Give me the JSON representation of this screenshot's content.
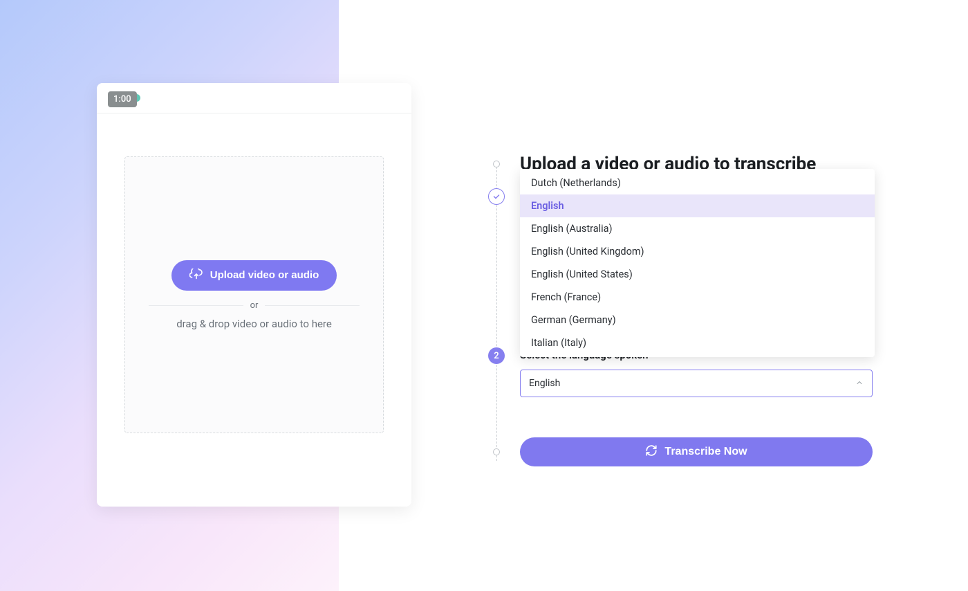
{
  "window": {
    "timer": "1:00"
  },
  "upload": {
    "button_label": "Upload video or audio",
    "or": "or",
    "drag_label": "drag & drop video or audio to here"
  },
  "steps": {
    "heading": "Upload a video or audio to transcribe",
    "step2_label": "Select the language spoken",
    "step2_number": "2"
  },
  "language": {
    "selected": "English",
    "options": [
      "Dutch (Netherlands)",
      "English",
      "English (Australia)",
      "English (United Kingdom)",
      "English (United States)",
      "French (France)",
      "German (Germany)",
      "Italian (Italy)"
    ]
  },
  "transcribe": {
    "label": "Transcribe Now"
  }
}
